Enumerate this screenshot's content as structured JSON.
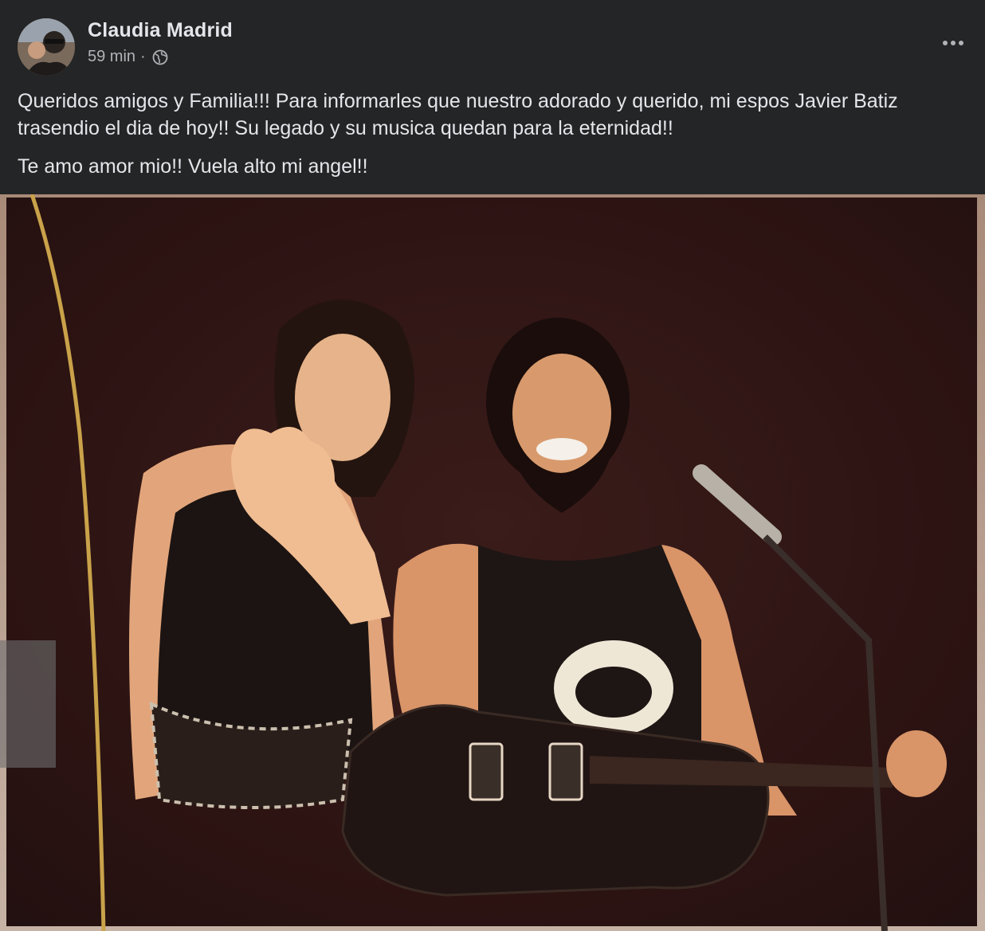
{
  "post": {
    "author": "Claudia Madrid",
    "timestamp": "59 min",
    "separator": "·",
    "audience_icon": "globe-icon",
    "more_icon": "more-options-icon",
    "paragraphs": [
      "Queridos amigos y Familia!!! Para informarles que nuestro adorado y querido, mi espos Javier Batiz trasendio el dia de hoy!! Su legado y su musica quedan para la eternidad!!",
      "Te amo amor mio!! Vuela alto mi angel!!"
    ],
    "photo": {
      "subject": "vintage photo of a woman waving and a smiling bearded guitarist on stage"
    }
  },
  "colors": {
    "background": "#242526",
    "primary_text": "#e4e6eb",
    "secondary_text": "#b0b3b8"
  }
}
